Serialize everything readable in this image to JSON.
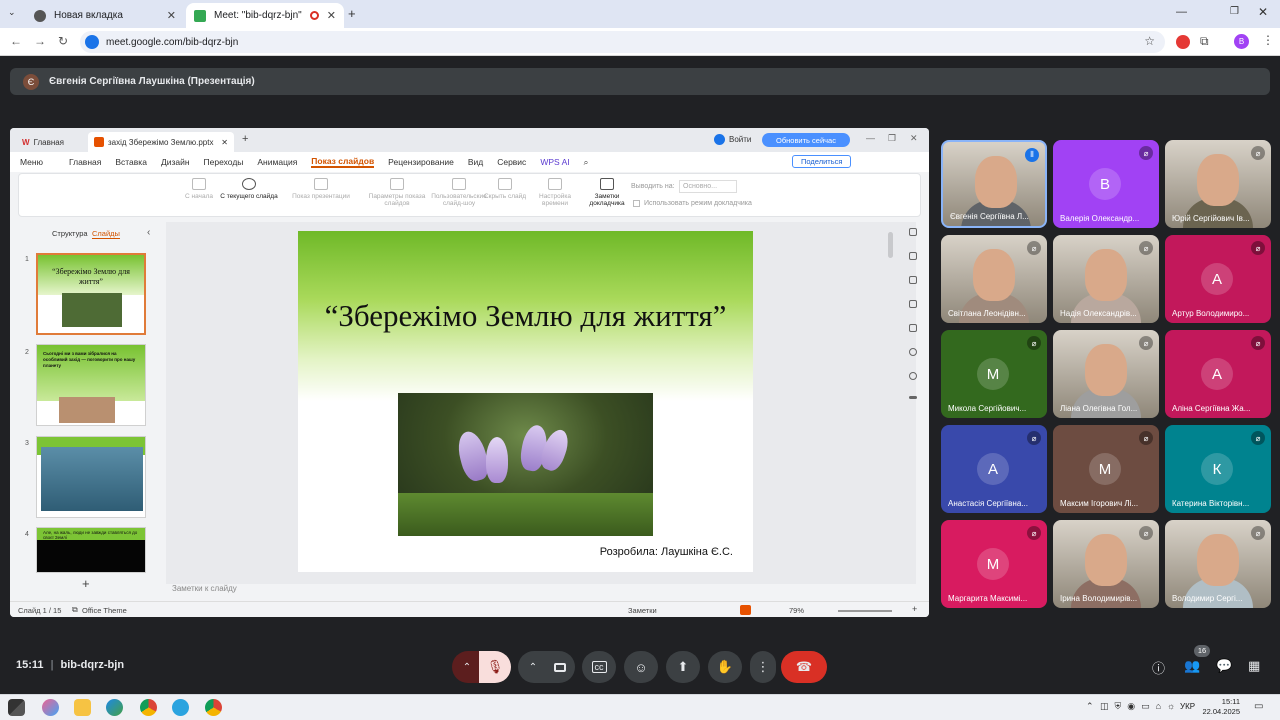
{
  "browser": {
    "tabs": [
      {
        "label": "Новая вкладка",
        "icon": "chrome-icon"
      },
      {
        "label": "Meet: \"bib-dqrz-bjn\"",
        "icon": "meet-icon"
      }
    ],
    "url": "meet.google.com/bib-dqrz-bjn",
    "profile_initial": "B"
  },
  "meet": {
    "presenter_label": "Євгенія Сергіївна Лаушкіна (Презентація)",
    "presenter_initial": "Є",
    "time": "15:11",
    "separator": "|",
    "code": "bib-dqrz-bjn",
    "participant_count": "16",
    "participants": [
      {
        "name": "Євгенія Сергіївна Л...",
        "initial": "",
        "color": "#5f6368",
        "mic": "speaking"
      },
      {
        "name": "Валерія Олександр...",
        "initial": "В",
        "color": "#a142f4",
        "mic": "muted"
      },
      {
        "name": "Юрій Сергійович Ів...",
        "initial": "",
        "color": "#6b6450",
        "mic": "muted"
      },
      {
        "name": "Світлана Леонідівн...",
        "initial": "",
        "color": "#a08b7d",
        "mic": "muted"
      },
      {
        "name": "Надія Олександрів...",
        "initial": "",
        "color": "#b9a89e",
        "mic": "muted"
      },
      {
        "name": "Артур Володимиро...",
        "initial": "А",
        "color": "#c2185b",
        "mic": "muted"
      },
      {
        "name": "Микола Сергійович...",
        "initial": "М",
        "color": "#33691e",
        "mic": "muted"
      },
      {
        "name": "Ліана Олегівна Гол...",
        "initial": "",
        "color": "#9e9e9e",
        "mic": "muted"
      },
      {
        "name": "Аліна Сергіївна Жа...",
        "initial": "А",
        "color": "#c2185b",
        "mic": "muted"
      },
      {
        "name": "Анастасія Сергіївна...",
        "initial": "А",
        "color": "#3949ab",
        "mic": "muted"
      },
      {
        "name": "Максим Ігорович Лі...",
        "initial": "М",
        "color": "#6d4c41",
        "mic": "muted"
      },
      {
        "name": "Катерина Вікторівн...",
        "initial": "К",
        "color": "#00838f",
        "mic": "muted"
      },
      {
        "name": "Маргарита Максимі...",
        "initial": "М",
        "color": "#d81b60",
        "mic": "muted"
      },
      {
        "name": "Ірина Володимирів...",
        "initial": "",
        "color": "#8d6e63",
        "mic": "muted"
      },
      {
        "name": "Володимир Сергі...",
        "initial": "",
        "color": "#b0bec5",
        "mic": "muted"
      }
    ]
  },
  "wps": {
    "tabs": [
      {
        "label": "Главная"
      },
      {
        "label": "захід Збережімо Землю.pptx"
      }
    ],
    "login": "Войти",
    "update_btn": "Обновить сейчас",
    "menu": [
      "Меню",
      "Главная",
      "Вставка",
      "Дизайн",
      "Переходы",
      "Анимация",
      "Показ слайдов",
      "Рецензирование",
      "Вид",
      "Сервис",
      "WPS AI"
    ],
    "active_menu": "Показ слайдов",
    "share": "Поделиться",
    "ribbon": [
      {
        "label": "С начала",
        "enabled": false
      },
      {
        "label": "С текущего слайда",
        "enabled": true
      },
      {
        "label": "Показ презентации",
        "enabled": false
      },
      {
        "label": "Параметры показа слайдов",
        "enabled": false
      },
      {
        "label": "Пользовательские слайд-шоу",
        "enabled": false
      },
      {
        "label": "Скрыть слайд",
        "enabled": false
      },
      {
        "label": "Настройка времени",
        "enabled": false
      },
      {
        "label": "Заметки докладчика",
        "enabled": true
      }
    ],
    "output_label": "Выводить на:",
    "output_value": "Основно...",
    "presenter_mode": "Использовать режим докладчика",
    "pane_tabs": [
      "Структура",
      "Слайды"
    ],
    "slide_thumbs": [
      {
        "num": "1",
        "title": "“Збережімо Землю для життя”"
      },
      {
        "num": "2",
        "title": "Сьогодні ми з вами зібралися на особливий захід — поговорити про нашу планету"
      },
      {
        "num": "3",
        "title": ""
      },
      {
        "num": "4",
        "title": "Але, на жаль, люди не завжди ставляться до своєї Землі"
      }
    ],
    "slide": {
      "title": "“Збережімо Землю для життя”",
      "author": "Розробила: Лаушкіна Є.С."
    },
    "notes_placeholder": "Заметки к слайду",
    "status": {
      "slide_counter": "Слайд 1 / 15",
      "theme": "Office Theme",
      "notes": "Заметки",
      "zoom": "79%"
    }
  },
  "taskbar": {
    "lang": "УКР",
    "time": "15:11",
    "date": "22.04.2025"
  }
}
